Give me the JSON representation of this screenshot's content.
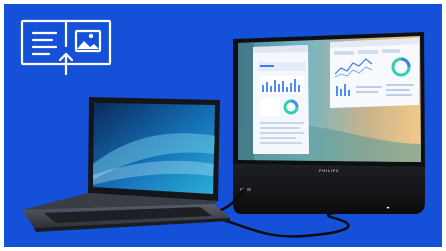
{
  "scene": {
    "background_color": "#1550d8",
    "icon": "dual-screen-extend-icon",
    "laptop_screen_colors": [
      "#0b2a5c",
      "#2ab0d8"
    ],
    "monitor_wallpaper_colors": [
      "#6fb6c6",
      "#f2c98a"
    ],
    "monitor_brand": "PHILIPS",
    "cable": "usb-c-cable"
  }
}
